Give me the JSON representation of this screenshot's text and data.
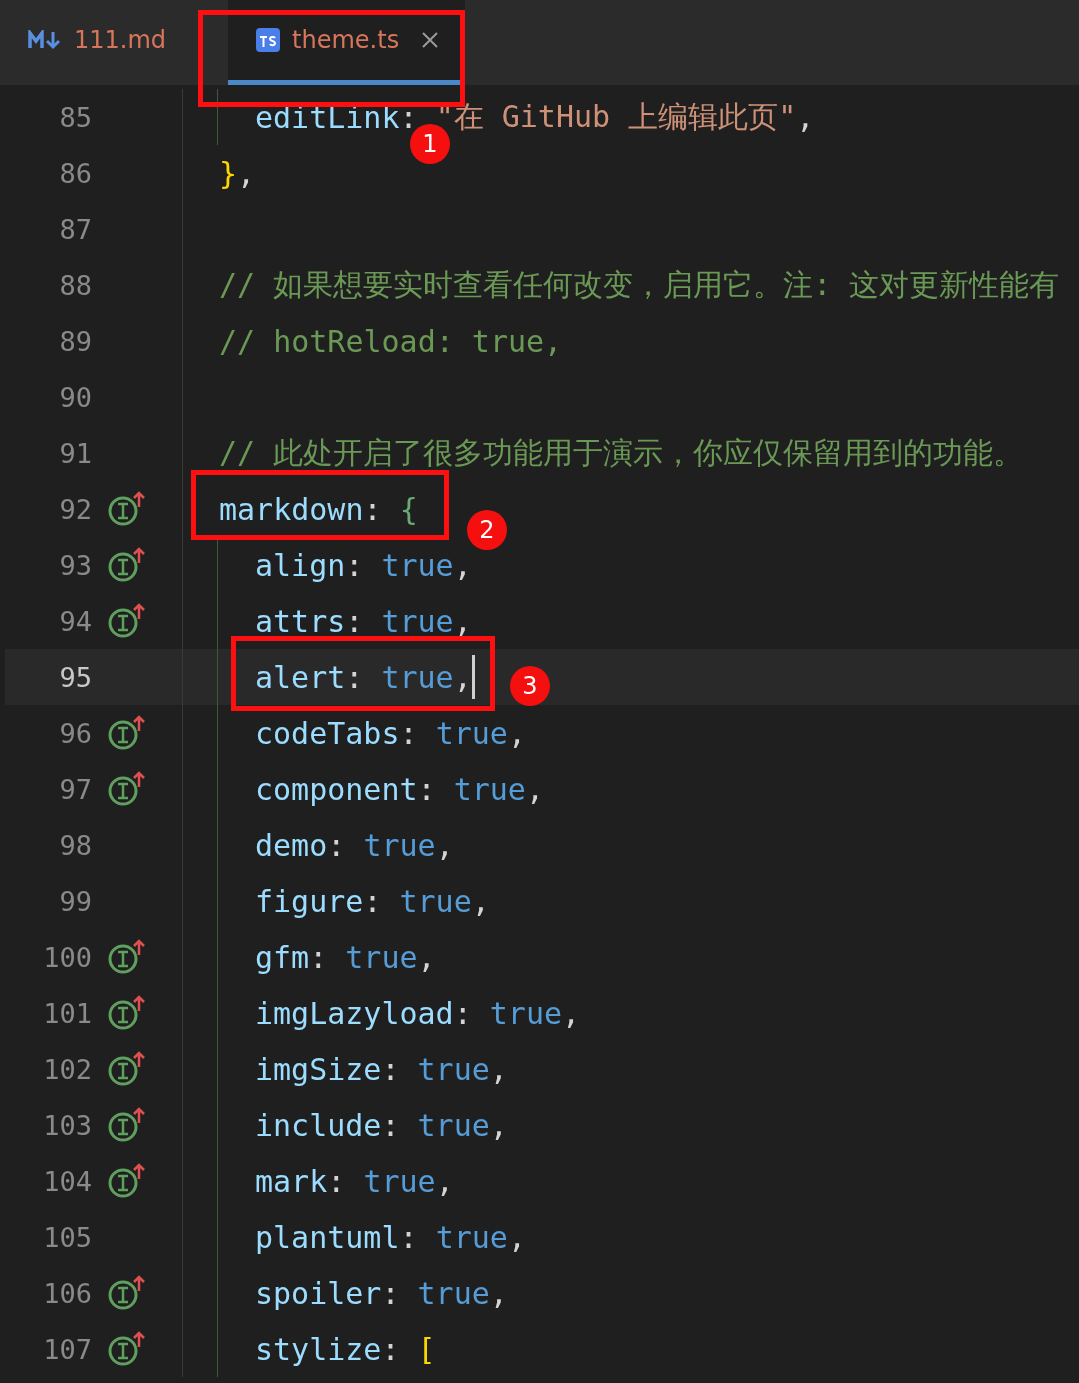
{
  "tabs": [
    {
      "label": "111.md",
      "selected": false,
      "closable": false
    },
    {
      "label": "theme.ts",
      "selected": true,
      "closable": true
    }
  ],
  "lines": [
    {
      "number": "85",
      "indented": true,
      "marker": false,
      "current": false,
      "tokens": [
        {
          "kind": "key",
          "text": "editLink"
        },
        {
          "kind": "punct",
          "text": ": "
        },
        {
          "kind": "string",
          "text": "\"在 GitHub 上编辑此页\""
        },
        {
          "kind": "punct",
          "text": ","
        }
      ]
    },
    {
      "number": "86",
      "indented": false,
      "marker": false,
      "current": false,
      "tokens": [
        {
          "kind": "brace",
          "text": "}"
        },
        {
          "kind": "punct",
          "text": ","
        }
      ]
    },
    {
      "number": "87",
      "indented": false,
      "marker": false,
      "current": false
    },
    {
      "number": "88",
      "indented": false,
      "marker": false,
      "current": false,
      "tokens": [
        {
          "kind": "comment",
          "text": "// 如果想要实时查看任何改变，启用它。注: 这对更新性能有"
        }
      ]
    },
    {
      "number": "89",
      "indented": false,
      "marker": false,
      "current": false,
      "tokens": [
        {
          "kind": "comment",
          "text": "// hotReload: true,"
        }
      ]
    },
    {
      "number": "90",
      "indented": false,
      "marker": false,
      "current": false
    },
    {
      "number": "91",
      "indented": false,
      "marker": false,
      "current": false,
      "tokens": [
        {
          "kind": "comment",
          "text": "// 此处开启了很多功能用于演示，你应仅保留用到的功能。"
        }
      ]
    },
    {
      "number": "92",
      "indented": false,
      "marker": true,
      "current": false,
      "tokens": [
        {
          "kind": "key",
          "text": "markdown"
        },
        {
          "kind": "punct",
          "text": ": "
        },
        {
          "kind": "brace2",
          "text": "{"
        }
      ],
      "children": [
        {
          "number": "93",
          "marker": true,
          "current": false,
          "tokens": [
            {
              "kind": "key",
              "text": "align"
            },
            {
              "kind": "punct",
              "text": ": "
            },
            {
              "kind": "keyword",
              "text": "true"
            },
            {
              "kind": "punct",
              "text": ","
            }
          ]
        },
        {
          "number": "94",
          "marker": true,
          "current": false,
          "tokens": [
            {
              "kind": "key",
              "text": "attrs"
            },
            {
              "kind": "punct",
              "text": ": "
            },
            {
              "kind": "keyword",
              "text": "true"
            },
            {
              "kind": "punct",
              "text": ","
            }
          ]
        },
        {
          "number": "95",
          "marker": false,
          "current": true,
          "tokens": [
            {
              "kind": "key",
              "text": "alert"
            },
            {
              "kind": "punct",
              "text": ": "
            },
            {
              "kind": "keyword",
              "text": "true"
            },
            {
              "kind": "punct",
              "text": ","
            }
          ]
        },
        {
          "number": "96",
          "marker": true,
          "current": false,
          "tokens": [
            {
              "kind": "key",
              "text": "codeTabs"
            },
            {
              "kind": "punct",
              "text": ": "
            },
            {
              "kind": "keyword",
              "text": "true"
            },
            {
              "kind": "punct",
              "text": ","
            }
          ]
        },
        {
          "number": "97",
          "marker": true,
          "current": false,
          "tokens": [
            {
              "kind": "key",
              "text": "component"
            },
            {
              "kind": "punct",
              "text": ": "
            },
            {
              "kind": "keyword",
              "text": "true"
            },
            {
              "kind": "punct",
              "text": ","
            }
          ]
        },
        {
          "number": "98",
          "marker": false,
          "current": false,
          "tokens": [
            {
              "kind": "key",
              "text": "demo"
            },
            {
              "kind": "punct",
              "text": ": "
            },
            {
              "kind": "keyword",
              "text": "true"
            },
            {
              "kind": "punct",
              "text": ","
            }
          ]
        },
        {
          "number": "99",
          "marker": false,
          "current": false,
          "tokens": [
            {
              "kind": "key",
              "text": "figure"
            },
            {
              "kind": "punct",
              "text": ": "
            },
            {
              "kind": "keyword",
              "text": "true"
            },
            {
              "kind": "punct",
              "text": ","
            }
          ]
        },
        {
          "number": "100",
          "marker": true,
          "current": false,
          "tokens": [
            {
              "kind": "key",
              "text": "gfm"
            },
            {
              "kind": "punct",
              "text": ": "
            },
            {
              "kind": "keyword",
              "text": "true"
            },
            {
              "kind": "punct",
              "text": ","
            }
          ]
        },
        {
          "number": "101",
          "marker": true,
          "current": false,
          "tokens": [
            {
              "kind": "key",
              "text": "imgLazyload"
            },
            {
              "kind": "punct",
              "text": ": "
            },
            {
              "kind": "keyword",
              "text": "true"
            },
            {
              "kind": "punct",
              "text": ","
            }
          ]
        },
        {
          "number": "102",
          "marker": true,
          "current": false,
          "tokens": [
            {
              "kind": "key",
              "text": "imgSize"
            },
            {
              "kind": "punct",
              "text": ": "
            },
            {
              "kind": "keyword",
              "text": "true"
            },
            {
              "kind": "punct",
              "text": ","
            }
          ]
        },
        {
          "number": "103",
          "marker": true,
          "current": false,
          "tokens": [
            {
              "kind": "key",
              "text": "include"
            },
            {
              "kind": "punct",
              "text": ": "
            },
            {
              "kind": "keyword",
              "text": "true"
            },
            {
              "kind": "punct",
              "text": ","
            }
          ]
        },
        {
          "number": "104",
          "marker": true,
          "current": false,
          "tokens": [
            {
              "kind": "key",
              "text": "mark"
            },
            {
              "kind": "punct",
              "text": ": "
            },
            {
              "kind": "keyword",
              "text": "true"
            },
            {
              "kind": "punct",
              "text": ","
            }
          ]
        },
        {
          "number": "105",
          "marker": false,
          "current": false,
          "tokens": [
            {
              "kind": "key",
              "text": "plantuml"
            },
            {
              "kind": "punct",
              "text": ": "
            },
            {
              "kind": "keyword",
              "text": "true"
            },
            {
              "kind": "punct",
              "text": ","
            }
          ]
        },
        {
          "number": "106",
          "marker": true,
          "current": false,
          "tokens": [
            {
              "kind": "key",
              "text": "spoiler"
            },
            {
              "kind": "punct",
              "text": ": "
            },
            {
              "kind": "keyword",
              "text": "true"
            },
            {
              "kind": "punct",
              "text": ","
            }
          ]
        },
        {
          "number": "107",
          "marker": true,
          "current": false,
          "tokens": [
            {
              "kind": "key",
              "text": "stylize"
            },
            {
              "kind": "punct",
              "text": ": "
            },
            {
              "kind": "brace",
              "text": "["
            }
          ]
        }
      ]
    }
  ],
  "annotations": [
    {
      "label": "1"
    },
    {
      "label": "2"
    },
    {
      "label": "3"
    }
  ]
}
